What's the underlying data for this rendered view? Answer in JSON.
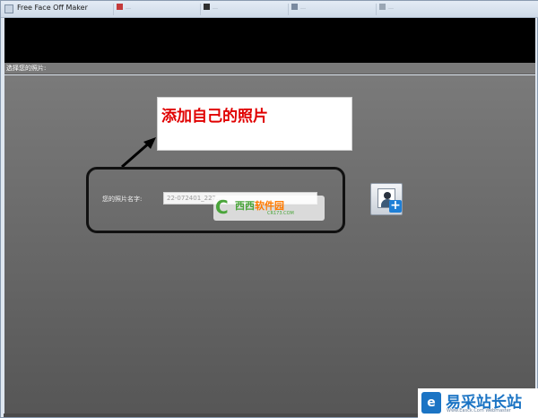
{
  "window": {
    "title": "Free Face Off Maker",
    "background_tabs": [
      {
        "label": "…",
        "color": "#c43a3a"
      },
      {
        "label": "…",
        "color": "#2f2f2f"
      },
      {
        "label": "…",
        "color": "#7a8aa0"
      },
      {
        "label": "…",
        "color": "#9aa6b4"
      }
    ]
  },
  "prompt": {
    "label": "选择您的照片:"
  },
  "annotation": {
    "callout_text": "添加自己的照片"
  },
  "form": {
    "name_label": "您的照片名字:",
    "name_value": "22-072401_227..."
  },
  "watermarks": {
    "center_glyph": "C",
    "center_name_a": "西西",
    "center_name_b": "软件园",
    "center_url": "CR173.COM",
    "corner_logo": "e",
    "corner_name": "易采站长站",
    "corner_url": "Www.Easck.Com Webmaster"
  },
  "colors": {
    "callout_text": "#e00000",
    "add_button_badge": "#1e7fd6",
    "stage_gray": "#6c6c6c"
  },
  "icons": {
    "add_photo": "add-photo-icon"
  }
}
